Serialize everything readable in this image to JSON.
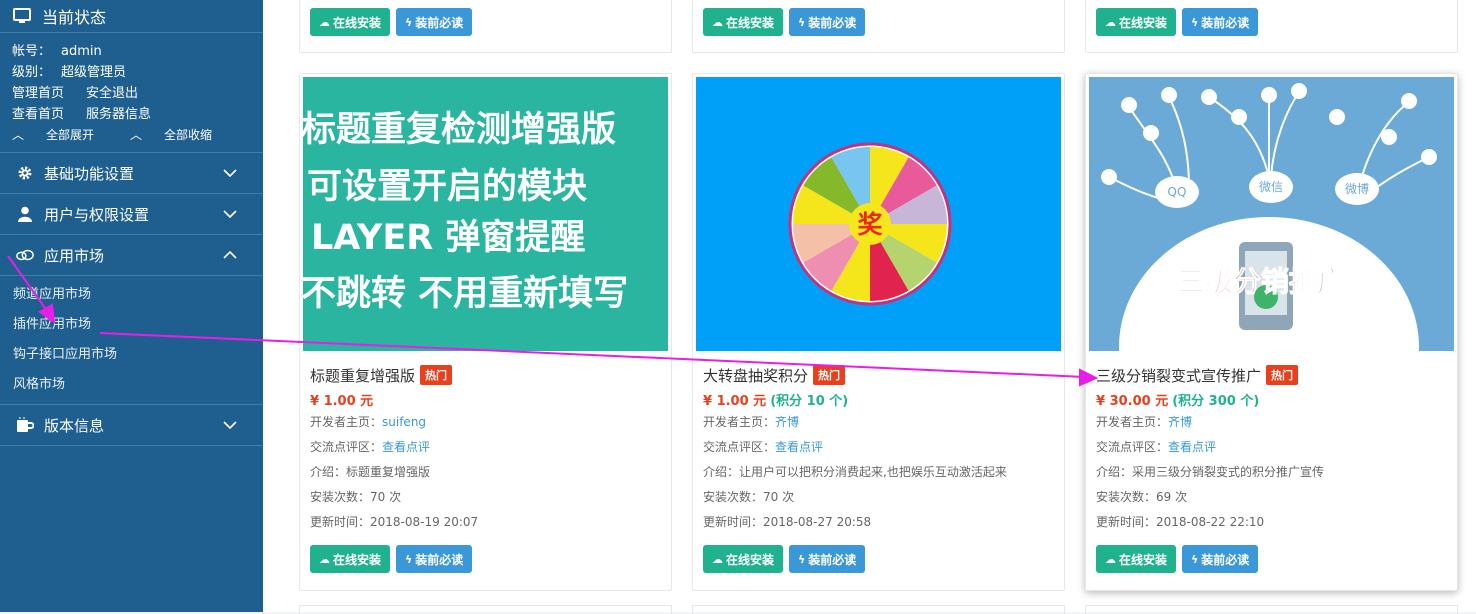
{
  "sidebar": {
    "header": "当前状态",
    "account_label": "帐号：",
    "account_value": "admin",
    "level_label": "级别：",
    "level_value": "超级管理员",
    "links": [
      "管理首页",
      "安全退出",
      "查看首页",
      "服务器信息"
    ],
    "expand_all": "全部展开",
    "collapse_all": "全部收缩",
    "sections": [
      {
        "label": "基础功能设置",
        "icon": "gear-icon"
      },
      {
        "label": "用户与权限设置",
        "icon": "user-icon"
      },
      {
        "label": "应用市场",
        "icon": "cloud-link-icon"
      }
    ],
    "app_market_items": [
      "频道应用市场",
      "插件应用市场",
      "钩子接口应用市场",
      "风格市场"
    ],
    "version_section": {
      "label": "版本信息",
      "icon": "coffee-cup-icon"
    }
  },
  "buttons": {
    "install": "在线安装",
    "readme": "装前必读"
  },
  "labels": {
    "developer": "开发者主页：",
    "review": "交流点评区：",
    "review_link": "查看点评",
    "intro": "介绍：",
    "installs": "安装次数：",
    "updated": "更新时间：",
    "hot": "热门"
  },
  "plugins": [
    {
      "title": "标题重复增强版",
      "price": "¥ 1.00 元",
      "points": "",
      "developer": "suifeng",
      "intro": "标题重复增强版",
      "installs": "70 次",
      "updated": "2018-08-19 20:07",
      "image_lines": [
        "标题重复检测增强版",
        "可设置开启的模块",
        "LAYER 弹窗提醒",
        "不跳转 不用重新填写"
      ]
    },
    {
      "title": "大转盘抽奖积分",
      "price": "¥ 1.00 元",
      "points": "(积分 10 个)",
      "developer": "齐博",
      "intro": "让用户可以把积分消费起来,也把娱乐互动激活起来",
      "installs": "70 次",
      "updated": "2018-08-27 20:58",
      "image_center": "奖"
    },
    {
      "title": "三级分销裂变式宣传推广",
      "price": "¥ 30.00 元",
      "points": "(积分 300 个)",
      "developer": "齐博",
      "intro": "采用三级分销裂变式的积分推广宣传",
      "installs": "69 次",
      "updated": "2018-08-22 22:10",
      "image_bubbles": [
        "QQ",
        "微信",
        "微博"
      ],
      "image_banner": "三级分销推广"
    }
  ],
  "colors": {
    "sidebar": "#1f5f8f",
    "green": "#20b28f",
    "blue": "#3a98d8",
    "hot": "#e8401d",
    "arrow": "#e81ee8"
  }
}
